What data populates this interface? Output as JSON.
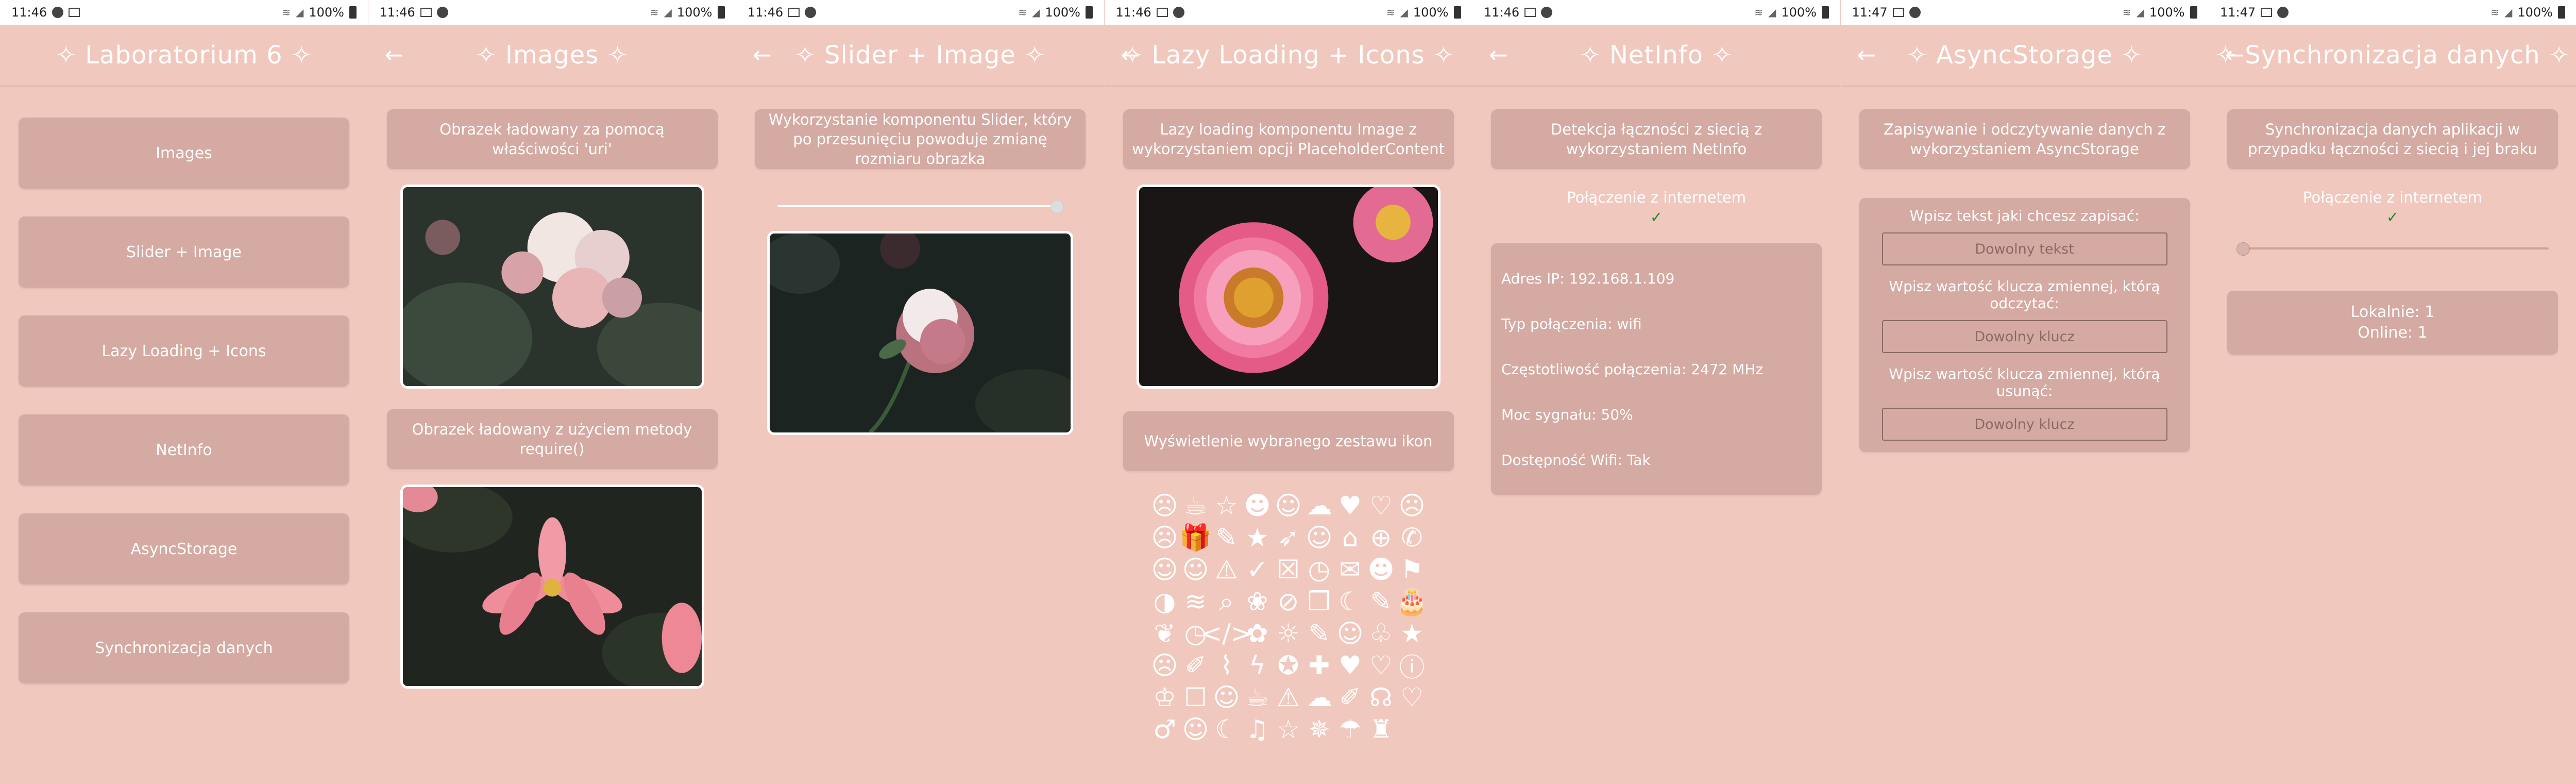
{
  "status": [
    {
      "time": "11:46",
      "battery": "100%"
    },
    {
      "time": "11:46",
      "battery": "100%"
    },
    {
      "time": "11:46",
      "battery": "100%"
    },
    {
      "time": "11:46",
      "battery": "100%"
    },
    {
      "time": "11:46",
      "battery": "100%"
    },
    {
      "time": "11:47",
      "battery": "100%"
    },
    {
      "time": "11:47",
      "battery": "100%"
    }
  ],
  "home": {
    "title": "✧ Laboratorium 6 ✧",
    "menu": [
      "Images",
      "Slider + Image",
      "Lazy Loading + Icons",
      "NetInfo",
      "AsyncStorage",
      "Synchronizacja danych"
    ]
  },
  "images": {
    "title": "✧ Images ✧",
    "card1": "Obrazek ładowany za pomocą właściwości 'uri'",
    "card2": "Obrazek ładowany z użyciem metody require()"
  },
  "slider": {
    "title": "✧ Slider + Image ✧",
    "card": "Wykorzystanie komponentu Slider, który po przesunięciu powoduje zmianę rozmiaru obrazka",
    "slider_value": 1.0
  },
  "lazy": {
    "title": "✧ Lazy Loading + Icons ✧",
    "card1": "Lazy loading komponentu Image z wykorzystaniem opcji PlaceholderContent",
    "card2": "Wyświetlenie wybranego zestawu ikon",
    "icons": [
      "☹",
      "☕",
      "☆",
      "☻",
      "☺",
      "☁",
      "♥",
      "♡",
      "☹",
      "☹",
      "🎁",
      "✎",
      "★",
      "➶",
      "☺",
      "⌂",
      "⊕",
      "✆",
      "☺",
      "☺",
      "⚠",
      "✓",
      "☒",
      "◷",
      "✉",
      "☻",
      "⚑",
      "◑",
      "≋",
      "⌕",
      "❀",
      "⊘",
      "❒",
      "☾",
      "✎",
      "🎂",
      "❦",
      "◷",
      "</>",
      "✿",
      "☼",
      "✎",
      "☺",
      "♧",
      "★",
      "☹",
      "✐",
      "⌇",
      "ϟ",
      "✪",
      "✚",
      "♥",
      "♡",
      "ⓘ",
      "♔",
      "☐",
      "☺",
      "☕",
      "⚠",
      "☁",
      "✐",
      "☊",
      "♡",
      "♂",
      "☺",
      "☾",
      "♫",
      "☆",
      "✵",
      "☂",
      "♜"
    ]
  },
  "netinfo": {
    "title": "✧ NetInfo ✧",
    "card": "Detekcja łączności z siecią z wykorzystaniem NetInfo",
    "connected_label": "Połączenie z internetem",
    "details": [
      "Adres IP: 192.168.1.109",
      "Typ połączenia: wifi",
      "Częstotliwość połączenia: 2472 MHz",
      "Moc sygnału: 50%",
      "Dostępność Wifi: Tak"
    ]
  },
  "async": {
    "title": "✧ AsyncStorage ✧",
    "card": "Zapisywanie i odczytywanie danych z wykorzystaniem AsyncStorage",
    "label1": "Wpisz tekst jaki chcesz zapisać:",
    "placeholder1": "Dowolny tekst",
    "label2": "Wpisz wartość klucza zmiennej, którą odczytać:",
    "placeholder2": "Dowolny klucz",
    "label3": "Wpisz wartość klucza zmiennej, którą usunąć:",
    "placeholder3": "Dowolny klucz"
  },
  "sync": {
    "title": "✧ Synchronizacja danych ✧",
    "card": "Synchronizacja danych aplikacji w przypadku łączności z siecią i jej braku",
    "connected_label": "Połączenie z internetem",
    "local": "Lokalnie: 1",
    "online": "Online: 1",
    "slider_value": 0.0
  }
}
